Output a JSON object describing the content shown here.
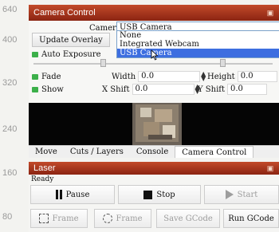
{
  "ruler": [
    "640",
    "400",
    "320",
    "240",
    "160",
    "80"
  ],
  "camera_panel": {
    "title": "Camera Control",
    "camera_label": "Camera:",
    "camera_value": "USB Camera",
    "camera_options": [
      "None",
      "Integrated Webcam",
      "USB Camera"
    ],
    "update_overlay": "Update Overlay",
    "auto_exposure": "Auto Exposure",
    "fade": "Fade",
    "show": "Show",
    "width_label": "Width",
    "width_value": "0.0",
    "height_label": "Height",
    "height_value": "0.0",
    "x_shift_label": "X Shift",
    "x_shift_value": "0.0",
    "y_shift_label": "Y Shift",
    "y_shift_value": "0.0"
  },
  "tabs": [
    "Move",
    "Cuts / Layers",
    "Console",
    "Camera Control"
  ],
  "laser_panel": {
    "title": "Laser",
    "status": "Ready",
    "pause": "Pause",
    "stop": "Stop",
    "start": "Start",
    "frame": "Frame",
    "frame_round": "Frame",
    "save_gcode": "Save GCode",
    "run_gcode": "Run GCode"
  },
  "colors": {
    "title_bar": "#a8341d",
    "checkbox": "#3cb04a",
    "selection": "#3d6ee0"
  }
}
